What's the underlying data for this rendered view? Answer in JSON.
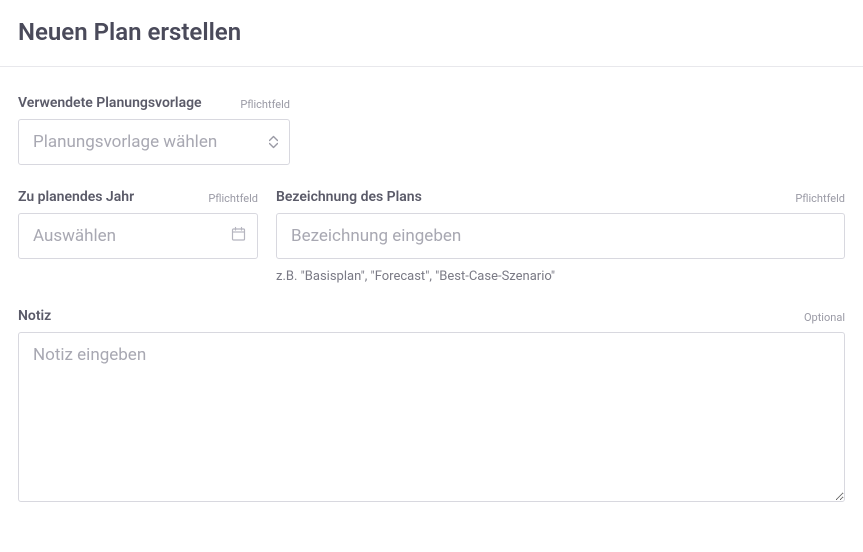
{
  "title": "Neuen Plan erstellen",
  "labels": {
    "required": "Pflichtfeld",
    "optional": "Optional"
  },
  "template": {
    "label": "Verwendete Planungsvorlage",
    "placeholder": "Planungsvorlage wählen"
  },
  "year": {
    "label": "Zu planendes Jahr",
    "placeholder": "Auswählen"
  },
  "name": {
    "label": "Bezeichnung des Plans",
    "placeholder": "Bezeichnung eingeben",
    "help": "z.B. \"Basisplan\", \"Forecast\", \"Best-Case-Szenario\""
  },
  "note": {
    "label": "Notiz",
    "placeholder": "Notiz eingeben"
  }
}
